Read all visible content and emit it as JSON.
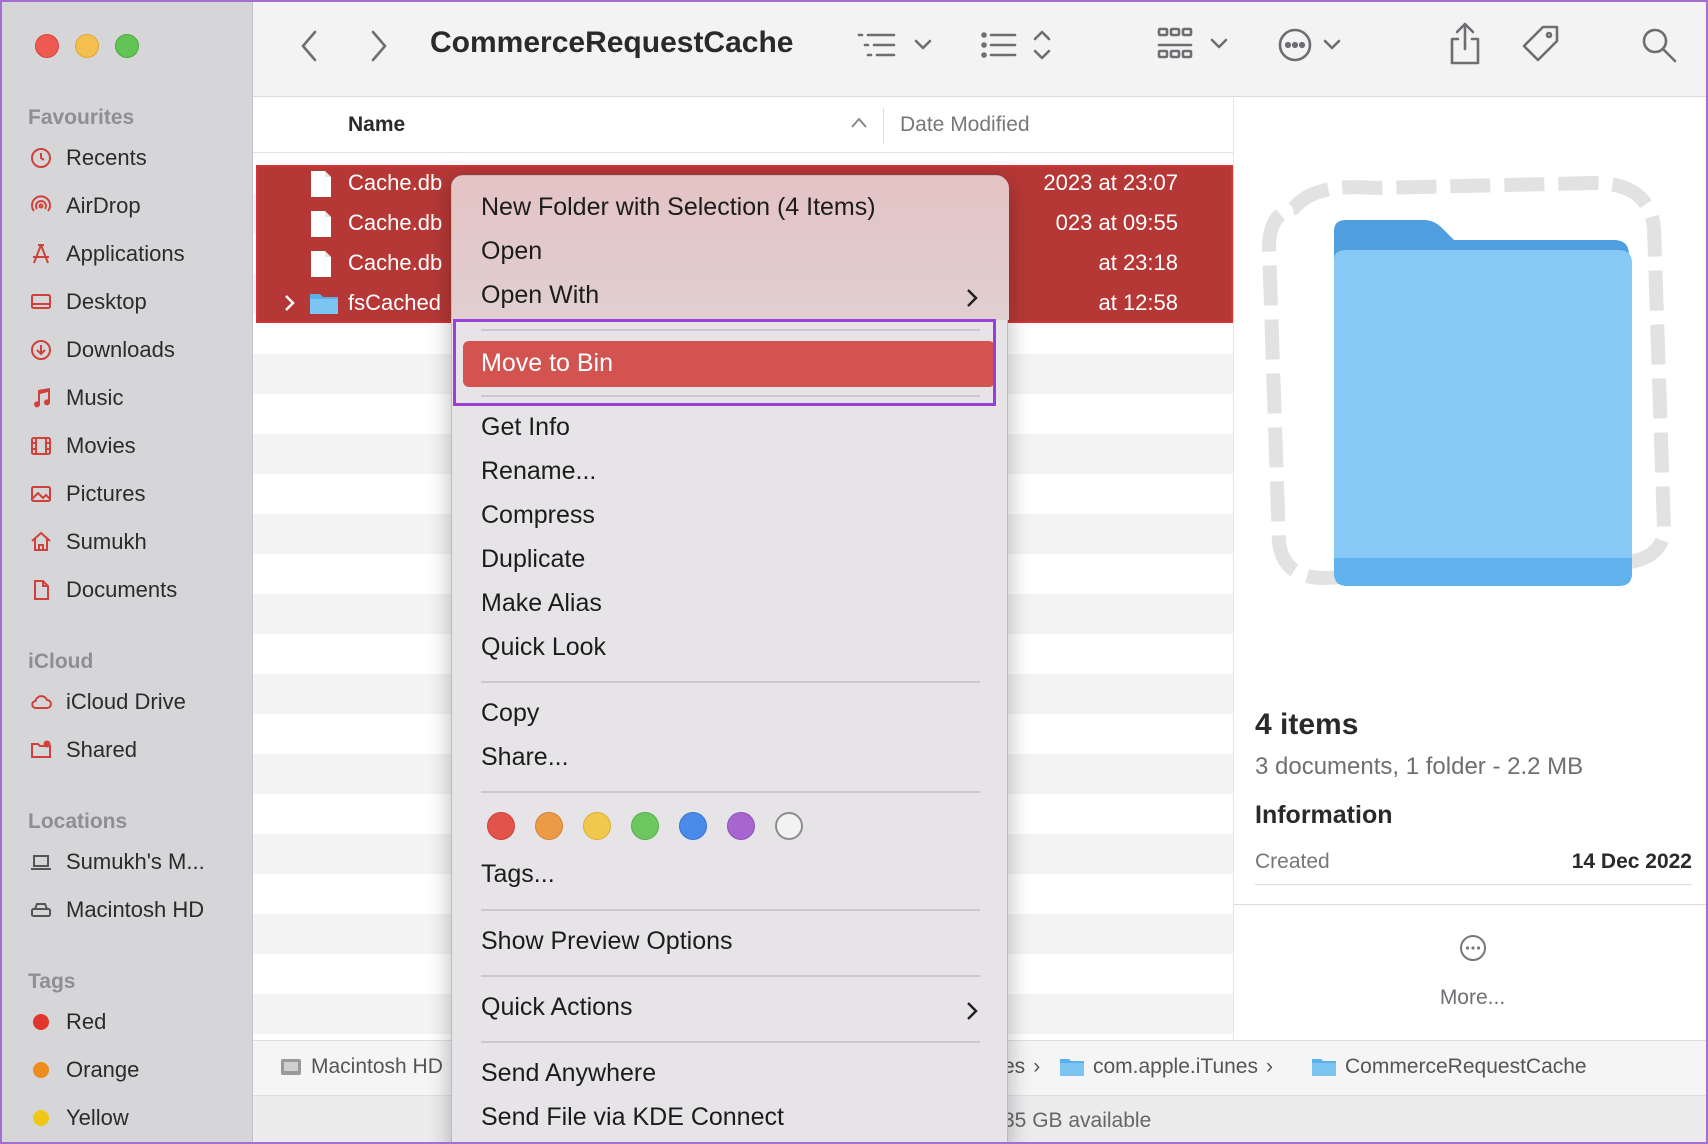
{
  "window": {
    "title": "CommerceRequestCache"
  },
  "sidebar": {
    "favourites_title": "Favourites",
    "favourites": [
      {
        "label": "Recents",
        "icon": "clock-icon"
      },
      {
        "label": "AirDrop",
        "icon": "airdrop-icon"
      },
      {
        "label": "Applications",
        "icon": "applications-icon"
      },
      {
        "label": "Desktop",
        "icon": "desktop-icon"
      },
      {
        "label": "Downloads",
        "icon": "download-icon"
      },
      {
        "label": "Music",
        "icon": "music-icon"
      },
      {
        "label": "Movies",
        "icon": "film-icon"
      },
      {
        "label": "Pictures",
        "icon": "picture-icon"
      },
      {
        "label": "Sumukh",
        "icon": "home-icon"
      },
      {
        "label": "Documents",
        "icon": "document-icon"
      }
    ],
    "icloud_title": "iCloud",
    "icloud": [
      {
        "label": "iCloud Drive",
        "icon": "cloud-icon"
      },
      {
        "label": "Shared",
        "icon": "shared-folder-icon"
      }
    ],
    "locations_title": "Locations",
    "locations": [
      {
        "label": "Sumukh's M...",
        "icon": "laptop-icon"
      },
      {
        "label": "Macintosh HD",
        "icon": "disk-icon"
      }
    ],
    "tags_title": "Tags",
    "tags": [
      {
        "label": "Red",
        "color": "#e2352d"
      },
      {
        "label": "Orange",
        "color": "#ee8c1d"
      },
      {
        "label": "Yellow",
        "color": "#f0c619"
      }
    ]
  },
  "columns": {
    "name": "Name",
    "date_modified": "Date Modified"
  },
  "files": [
    {
      "name": "Cache.db",
      "date": "2023 at 23:07",
      "kind": "document"
    },
    {
      "name": "Cache.db",
      "date": "023 at 09:55",
      "kind": "document"
    },
    {
      "name": "Cache.db",
      "date": "at 23:18",
      "kind": "document"
    },
    {
      "name": "fsCached",
      "date": "at 12:58",
      "kind": "folder"
    }
  ],
  "context_menu": {
    "items": [
      {
        "label": "New Folder with Selection (4 Items)"
      },
      {
        "label": "Open"
      },
      {
        "label": "Open With",
        "submenu": true
      },
      {
        "label": "Move to Bin",
        "highlighted": true
      },
      {
        "label": "Get Info"
      },
      {
        "label": "Rename..."
      },
      {
        "label": "Compress"
      },
      {
        "label": "Duplicate"
      },
      {
        "label": "Make Alias"
      },
      {
        "label": "Quick Look"
      },
      {
        "label": "Copy"
      },
      {
        "label": "Share..."
      },
      {
        "label": "Tags..."
      },
      {
        "label": "Show Preview Options"
      },
      {
        "label": "Quick Actions",
        "submenu": true
      },
      {
        "label": "Send Anywhere"
      },
      {
        "label": "Send File via KDE Connect"
      }
    ],
    "tag_colors": [
      "#e2534b",
      "#eb9a45",
      "#f0c84c",
      "#6bc75e",
      "#4a8ae8",
      "#a865cf",
      "#ffffff"
    ]
  },
  "preview": {
    "count": "4 items",
    "summary": "3 documents, 1 folder - 2.2 MB",
    "info_title": "Information",
    "created_label": "Created",
    "created_value": "14 Dec 2022",
    "more": "More..."
  },
  "pathbar": {
    "root": "Macintosh HD",
    "partial": "es",
    "folder1": "com.apple.iTunes",
    "folder2": "CommerceRequestCache"
  },
  "status": {
    "available": "35 GB available"
  },
  "colors": {
    "selection": "#b53836",
    "highlight": "#d35351",
    "annotation_frame": "#9a40d8"
  }
}
